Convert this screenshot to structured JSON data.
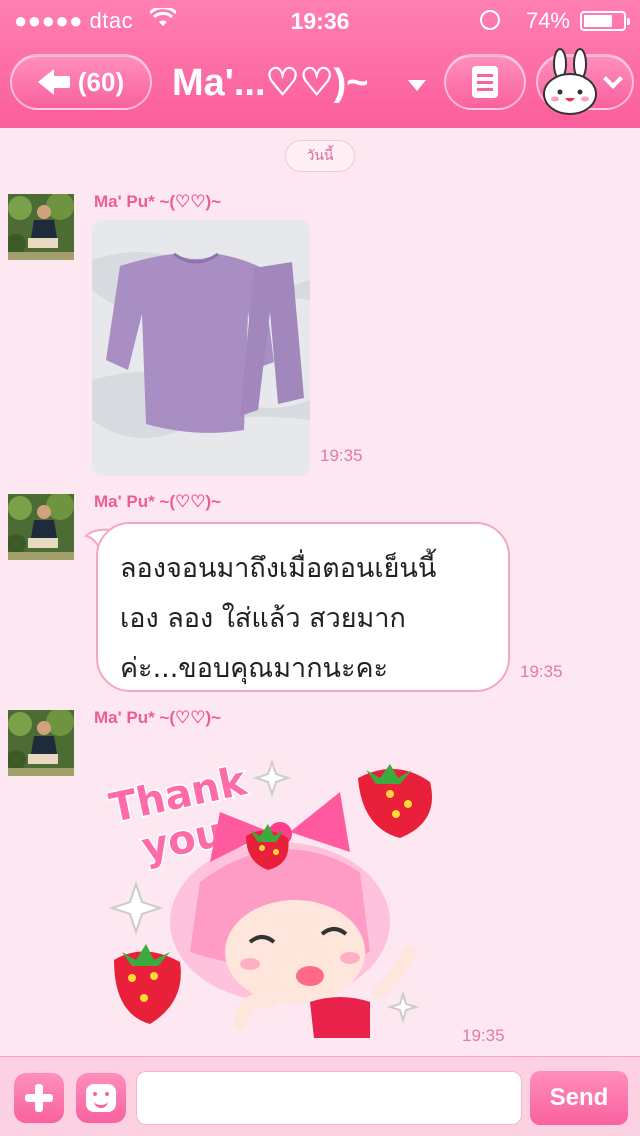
{
  "status_bar": {
    "carrier": "●●●●● dtac",
    "time": "19:36",
    "battery_percent": "74%",
    "battery_level": 0.74
  },
  "header": {
    "back_label": "(60)",
    "title": "Ma'...♡♡)~",
    "icons": [
      "back-arrow-icon",
      "chevron-down-icon",
      "note-icon",
      "bunny-avatar-icon"
    ]
  },
  "chat": {
    "date_label": "วันนี้",
    "messages": [
      {
        "sender": "Ma' Pu* ~(♡♡)~",
        "type": "photo",
        "time": "19:35"
      },
      {
        "sender": "Ma' Pu* ~(♡♡)~",
        "type": "text",
        "lines": [
          "ลองจอนมาถึงเมื่อตอนเย็นนี้",
          "เอง ลอง ใส่แล้ว สวยมาก",
          "ค่ะ...ขอบคุณมากนะคะ"
        ],
        "time": "19:35"
      },
      {
        "sender": "Ma' Pu* ~(♡♡)~",
        "type": "sticker",
        "sticker_text": [
          "Thank",
          "you."
        ],
        "time": "19:35"
      }
    ]
  },
  "composer": {
    "input_value": "",
    "send_label": "Send"
  },
  "colors": {
    "accent": "#fb5e9c",
    "background": "#fde8f1"
  }
}
